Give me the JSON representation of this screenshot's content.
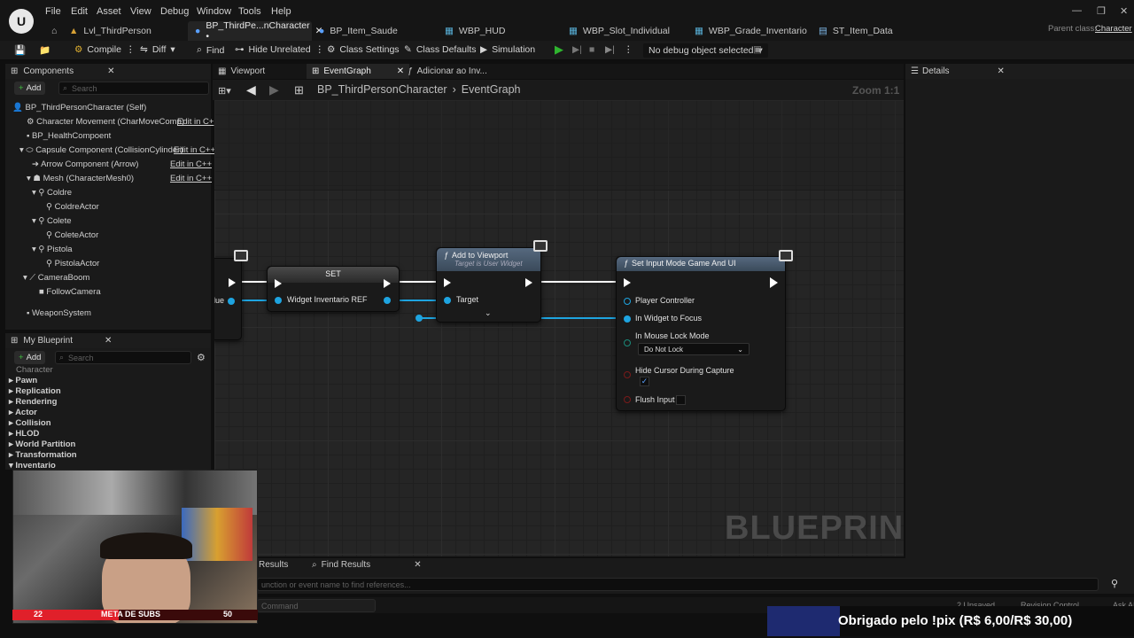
{
  "app": {
    "menu": [
      "File",
      "Edit",
      "Asset",
      "View",
      "Debug",
      "Window",
      "Tools",
      "Help"
    ],
    "tabs": [
      {
        "label": "Lvl_ThirdPerson"
      },
      {
        "label": "BP_ThirdPe...nCharacter •"
      },
      {
        "label": "BP_Item_Saude"
      },
      {
        "label": "WBP_HUD"
      },
      {
        "label": "WBP_Slot_Individual"
      },
      {
        "label": "WBP_Grade_Inventario"
      },
      {
        "label": "ST_Item_Data"
      }
    ],
    "parent_class_label": "Parent class:",
    "parent_class_value": "Character"
  },
  "toolbar": {
    "compile": "Compile",
    "diff": "Diff",
    "find": "Find",
    "hide_unrelated": "Hide Unrelated",
    "class_settings": "Class Settings",
    "class_defaults": "Class Defaults",
    "simulation": "Simulation",
    "debug_object": "No debug object selected"
  },
  "components": {
    "title": "Components",
    "add": "Add",
    "search_placeholder": "Search",
    "items": [
      {
        "label": "BP_ThirdPersonCharacter (Self)",
        "edit": ""
      },
      {
        "label": "Character Movement (CharMoveComp)",
        "edit": "Edit in C+"
      },
      {
        "label": "BP_HealthCompoent",
        "edit": ""
      },
      {
        "label": "Capsule Component (CollisionCylinder)",
        "edit": "Edit in C++"
      },
      {
        "label": "Arrow Component (Arrow)",
        "edit": "Edit in C++"
      },
      {
        "label": "Mesh (CharacterMesh0)",
        "edit": "Edit in C++"
      },
      {
        "label": "Coldre",
        "edit": ""
      },
      {
        "label": "ColdreActor",
        "edit": ""
      },
      {
        "label": "Colete",
        "edit": ""
      },
      {
        "label": "ColeteActor",
        "edit": ""
      },
      {
        "label": "Pistola",
        "edit": ""
      },
      {
        "label": "PistolaActor",
        "edit": ""
      },
      {
        "label": "CameraBoom",
        "edit": ""
      },
      {
        "label": "FollowCamera",
        "edit": ""
      },
      {
        "label": "WeaponSystem",
        "edit": ""
      }
    ]
  },
  "my_blueprint": {
    "title": "My Blueprint",
    "add": "Add",
    "search_placeholder": "Search",
    "categories": [
      "Character",
      "Pawn",
      "Replication",
      "Rendering",
      "Actor",
      "Collision",
      "HLOD",
      "World Partition",
      "Transformation",
      "Inventario"
    ]
  },
  "graph_tabs": {
    "viewport": "Viewport",
    "event_graph": "EventGraph",
    "adicionar": "Adicionar ao Inv..."
  },
  "breadcrumb": {
    "blueprint": "BP_ThirdPersonCharacter",
    "graph": "EventGraph",
    "zoom": "Zoom 1:1"
  },
  "nodes": {
    "set": {
      "title": "SET",
      "pin": "Widget Inventario REF",
      "left_pin": "lue"
    },
    "add_to_viewport": {
      "title": "Add to Viewport",
      "subtitle": "Target is User Widget",
      "pin": "Target"
    },
    "set_input_mode": {
      "title": "Set Input Mode Game And UI",
      "pins": [
        "Player Controller",
        "In Widget to Focus",
        "In Mouse Lock Mode",
        "Hide Cursor During Capture",
        "Flush Input"
      ],
      "lock_mode": "Do Not Lock",
      "hide_cursor_checked": true,
      "flush_input_checked": false
    }
  },
  "watermark": "BLUEPRINT",
  "details": {
    "title": "Details"
  },
  "bottom": {
    "results_tab": "Results",
    "find_results": "Find Results",
    "find_placeholder": "unction or event name to find references...",
    "command_placeholder": "Command",
    "unsaved": "2 Unsaved",
    "revision": "Revision Control",
    "ask": "Ask AI"
  },
  "overlay": {
    "subs_left": "22",
    "subs_label": "META DE SUBS",
    "subs_right": "50",
    "pix_text": "Obrigado pelo !pix (R$ 6,00/R$ 30,00)"
  },
  "colors": {
    "object_pin": "#1ea4e0",
    "function_head": "#4a5d72",
    "accent_green": "#2fb52f"
  }
}
